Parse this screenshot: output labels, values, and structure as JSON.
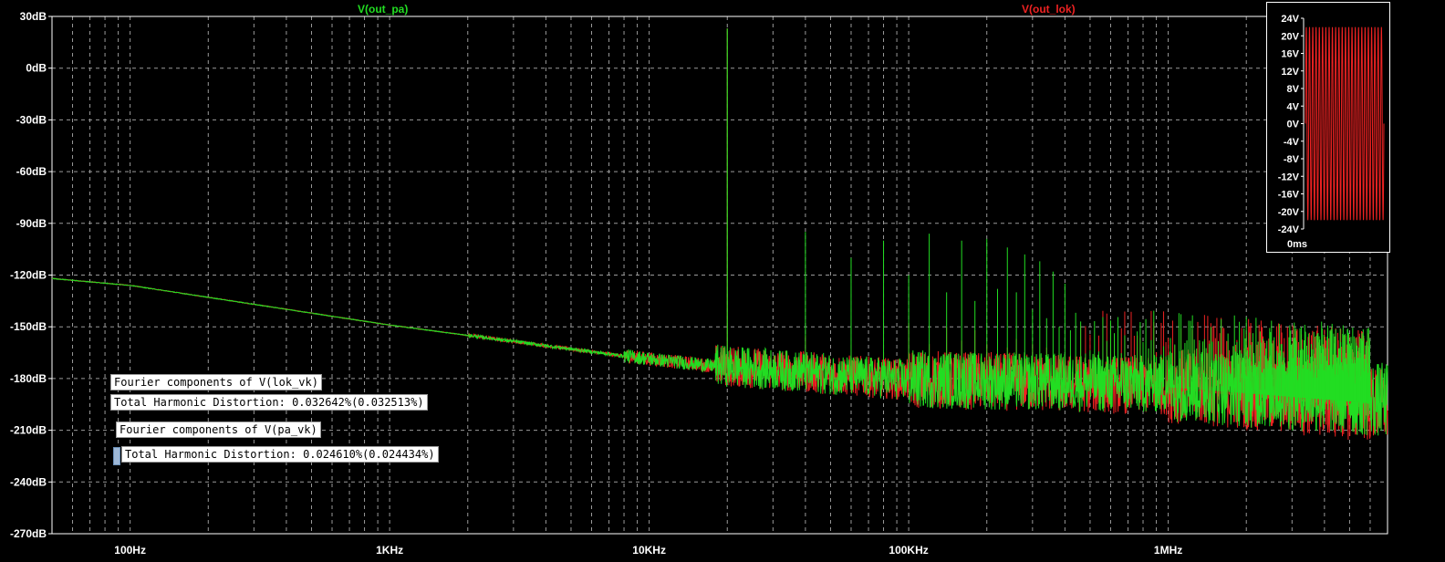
{
  "traces": {
    "left_label": "V(out_pa)",
    "left_color": "#22dd22",
    "right_label": "V(out_lok)",
    "right_color": "#ee2222"
  },
  "chart_data": [
    {
      "type": "line",
      "x_scale": "log",
      "xlim": [
        50,
        7000000
      ],
      "ylim": [
        -270,
        30
      ],
      "y_ticks": [
        30,
        0,
        -30,
        -60,
        -90,
        -120,
        -150,
        -180,
        -210,
        -240,
        -270
      ],
      "y_tick_labels": [
        "30dB",
        "0dB",
        "-30dB",
        "-60dB",
        "-90dB",
        "-120dB",
        "-150dB",
        "-180dB",
        "-210dB",
        "-240dB",
        "-270dB"
      ],
      "x_ticks": [
        100,
        1000,
        10000,
        100000,
        1000000
      ],
      "x_tick_labels": [
        "100Hz",
        "1KHz",
        "10KHz",
        "100KHz",
        "1MHz"
      ],
      "grid": true,
      "series": [
        {
          "name": "V(out_pa)",
          "color": "#22dd22",
          "fundamental_hz": 20000,
          "fundamental_db": 23,
          "noise_floor": {
            "x": [
              50,
              100,
              1000,
              10000,
              20000,
              100000,
              1000000,
              7000000
            ],
            "y": [
              -122,
              -126,
              -149,
              -169,
              -174,
              -182,
              -185,
              -195
            ]
          },
          "harmonic_peaks_db": [
            -95,
            -110,
            -100,
            -120,
            -96,
            -130,
            -100,
            -135,
            -99,
            -128,
            -104,
            -130,
            -108,
            -140,
            -112,
            -145,
            -118,
            -150,
            -125,
            -152
          ]
        },
        {
          "name": "V(out_lok)",
          "color": "#ee2222",
          "fundamental_hz": 20000,
          "fundamental_db": 23,
          "noise_floor": {
            "x": [
              50,
              100,
              1000,
              10000,
              20000,
              100000,
              1000000,
              7000000
            ],
            "y": [
              -122,
              -126,
              -149,
              -169,
              -174,
              -182,
              -186,
              -198
            ]
          },
          "harmonic_peaks_db": [
            -155,
            -160,
            -165,
            -148,
            -160,
            -150,
            -158,
            -152,
            -160,
            -155,
            -162,
            -157,
            -165,
            -160,
            -166,
            -162,
            -168,
            -165,
            -170,
            -168
          ]
        }
      ]
    },
    {
      "type": "line",
      "ylim": [
        -24,
        24
      ],
      "y_ticks": [
        24,
        20,
        16,
        12,
        8,
        4,
        0,
        -4,
        -8,
        -12,
        -16,
        -20,
        -24
      ],
      "y_tick_labels": [
        "24V",
        "20V",
        "16V",
        "12V",
        "8V",
        "4V",
        "0V",
        "-4V",
        "-8V",
        "-12V",
        "-16V",
        "-20V",
        "-24V"
      ],
      "x_tick_labels": [
        "0ms"
      ],
      "series": [
        {
          "name": "V(out_lok)",
          "color": "#ee2222",
          "amplitude_v": 22,
          "cycles_visible": 24
        }
      ]
    }
  ],
  "notes": [
    {
      "title": "Fourier components of V(lok_vk)",
      "thd": "Total Harmonic Distortion: 0.032642%(0.032513%)"
    },
    {
      "title": "Fourier components of V(pa_vk)",
      "thd": "Total Harmonic Distortion: 0.024610%(0.024434%)"
    }
  ]
}
